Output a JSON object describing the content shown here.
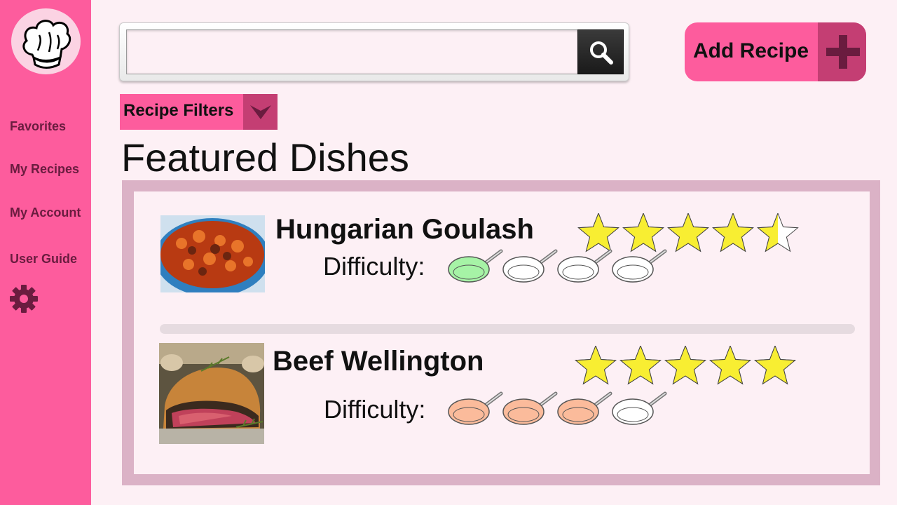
{
  "sidebar": {
    "items": [
      {
        "label": "Favorites"
      },
      {
        "label": "My Recipes"
      },
      {
        "label": "My Account"
      },
      {
        "label": "User Guide"
      }
    ],
    "settings_icon": "gear-icon",
    "logo_icon": "chef-hat-icon"
  },
  "search": {
    "value": "",
    "placeholder": "",
    "icon": "search-icon"
  },
  "add_recipe": {
    "label": "Add Recipe",
    "icon": "plus-icon"
  },
  "filters": {
    "label": "Recipe Filters",
    "icon": "chevron-down-icon"
  },
  "featured": {
    "title": "Featured Dishes",
    "dishes": [
      {
        "name": "Hungarian Goulash",
        "rating": 4.5,
        "rating_max": 5,
        "difficulty_label": "Difficulty:",
        "difficulty": 1,
        "difficulty_max": 4,
        "pan_color": "#a6f3a6"
      },
      {
        "name": "Beef Wellington",
        "rating": 5,
        "rating_max": 5,
        "difficulty_label": "Difficulty:",
        "difficulty": 3,
        "difficulty_max": 4,
        "pan_color": "#fbbb9b"
      }
    ]
  },
  "colors": {
    "accent": "#fd5c9d",
    "accent_dark": "#c43e73",
    "star": "#f8ee32",
    "panel_border": "#dbb2c6"
  }
}
